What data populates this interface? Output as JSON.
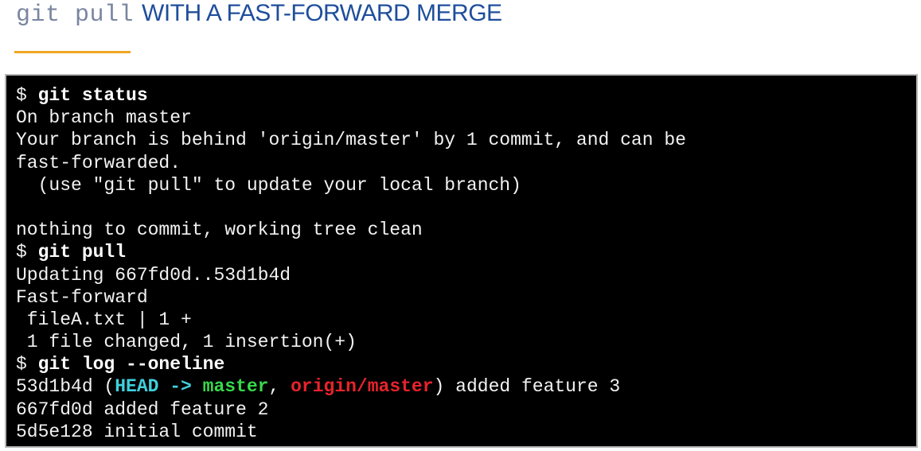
{
  "header": {
    "title_code": "git pull",
    "title_text": "WITH A FAST-FORWARD MERGE"
  },
  "colors": {
    "title_code": "#7a86a0",
    "title_text": "#1f4e9c",
    "underline": "#f0a623",
    "terminal_bg": "#000000",
    "head_ref": "#3fd0dc",
    "master_ref": "#38d84a",
    "origin_ref": "#e8232b"
  },
  "terminal": {
    "prompt": "$ ",
    "cmd_status": "git status",
    "status_lines": [
      "On branch master",
      "Your branch is behind 'origin/master' by 1 commit, and can be",
      "fast-forwarded.",
      "  (use \"git pull\" to update your local branch)",
      "",
      "nothing to commit, working tree clean"
    ],
    "cmd_pull": "git pull",
    "pull_lines": [
      "Updating 667fd0d..53d1b4d",
      "Fast-forward",
      " fileA.txt | 1 +",
      " 1 file changed, 1 insertion(+)"
    ],
    "cmd_log": "git log --oneline",
    "log_first": {
      "hash": "53d1b4d",
      "open": " (",
      "head": "HEAD ->",
      "space": " ",
      "master": "master",
      "comma": ", ",
      "origin": "origin/master",
      "close": ")",
      "message": " added feature 3"
    },
    "log_lines": [
      "667fd0d added feature 2",
      "5d5e128 initial commit"
    ]
  }
}
